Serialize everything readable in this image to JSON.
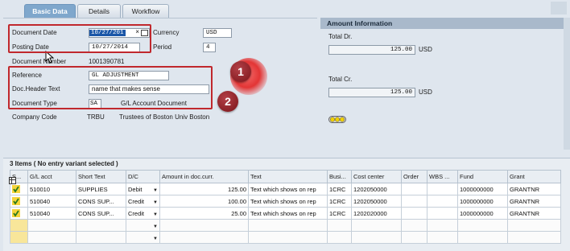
{
  "tabs": [
    {
      "label": "Basic Data",
      "active": true
    },
    {
      "label": "Details",
      "active": false
    },
    {
      "label": "Workflow",
      "active": false
    }
  ],
  "header": {
    "document_date": {
      "label": "Document Date",
      "value": "10/27/201"
    },
    "posting_date": {
      "label": "Posting Date",
      "value": "10/27/2014"
    },
    "document_number": {
      "label": "Document Number",
      "value": "1001390781"
    },
    "currency": {
      "label": "Currency",
      "value": "USD"
    },
    "period": {
      "label": "Period",
      "value": "4"
    },
    "reference": {
      "label": "Reference",
      "value": "GL ADJUSTMENT"
    },
    "doc_header_text": {
      "label": "Doc.Header Text",
      "value": "name that makes sense"
    },
    "document_type": {
      "label": "Document Type",
      "value": "SA",
      "description": "G/L Account Document"
    },
    "company_code": {
      "label": "Company Code",
      "value": "TRBU",
      "description": "Trustees of Boston Univ Boston"
    }
  },
  "callouts": [
    "1",
    "2"
  ],
  "amount_info": {
    "title": "Amount Information",
    "total_dr_label": "Total Dr.",
    "total_dr_value": "125.00",
    "total_dr_currency": "USD",
    "total_cr_label": "Total Cr.",
    "total_cr_value": "125.00",
    "total_cr_currency": "USD",
    "status_icon": "traffic-light-icon"
  },
  "items": {
    "title": "3 Items ( No entry variant selected )",
    "columns": [
      "S...",
      "G/L acct",
      "Short Text",
      "D/C",
      "Amount in doc.curr.",
      "Text",
      "Busi...",
      "Cost center",
      "Order",
      "WBS ...",
      "Fund",
      "Grant"
    ],
    "rows": [
      {
        "gl": "510010",
        "short": "SUPPLIES",
        "dc": "Debit",
        "amount": "125.00",
        "text": "Text which shows on rep",
        "busi": "1CRC",
        "cost": "1202050000",
        "order": "",
        "wbs": "",
        "fund": "1000000000",
        "grant": "GRANTNR"
      },
      {
        "gl": "510040",
        "short": "CONS SUP...",
        "dc": "Credit",
        "amount": "100.00",
        "text": "Text which shows on rep",
        "busi": "1CRC",
        "cost": "1202050000",
        "order": "",
        "wbs": "",
        "fund": "1000000000",
        "grant": "GRANTNR"
      },
      {
        "gl": "510040",
        "short": "CONS SUP...",
        "dc": "Credit",
        "amount": "25.00",
        "text": "Text which shows on rep",
        "busi": "1CRC",
        "cost": "1202020000",
        "order": "",
        "wbs": "",
        "fund": "1000000000",
        "grant": "GRANTNR"
      }
    ]
  },
  "colors": {
    "accent": "#7fa7cc",
    "highlight": "#c0282d",
    "selection": "#1b57a8"
  }
}
